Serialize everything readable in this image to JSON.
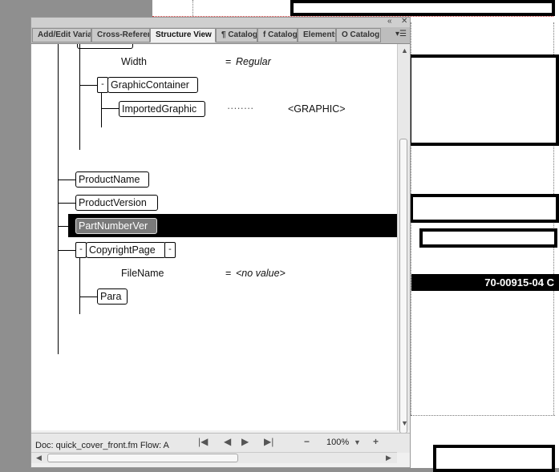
{
  "window_controls": {
    "collapse": "«",
    "close": "✕"
  },
  "tabs": [
    {
      "label": "Add/Edit Variable"
    },
    {
      "label": "Cross-Reference"
    },
    {
      "label": "Structure View"
    },
    {
      "label": "¶ Catalog"
    },
    {
      "label": "f Catalog"
    },
    {
      "label": "Elements"
    },
    {
      "label": "O Catalog"
    }
  ],
  "tab_menu": "▾☰",
  "tree": {
    "width_attr": {
      "name": "Width",
      "eq": "=",
      "value": "Regular"
    },
    "graphic_container": {
      "toggle": "-",
      "label": "GraphicContainer"
    },
    "imported_graphic": {
      "label": "ImportedGraphic",
      "dots": "········",
      "value": "<GRAPHIC>"
    },
    "product_name": {
      "label": "ProductName"
    },
    "product_version": {
      "label": "ProductVersion"
    },
    "part_number": {
      "label": "PartNumberVer"
    },
    "copyright_page": {
      "toggle_left": "-",
      "label": "CopyrightPage",
      "toggle_right": "-"
    },
    "filename_attr": {
      "name": "FileName",
      "eq": "=",
      "value": "<no value>"
    },
    "para": {
      "label": "Para"
    }
  },
  "statusbar": {
    "doc_info": "Doc: quick_cover_front.fm Flow: A",
    "nav_first": "|◀",
    "nav_prev": "◀",
    "nav_next": "▶",
    "nav_last": "▶|",
    "zoom_out": "−",
    "zoom": "100%",
    "zoom_dropdown": "▼",
    "zoom_in": "+"
  },
  "document": {
    "part_number_text": "70-00915-04 C"
  },
  "colors": {
    "selection": "#000000",
    "panel_bg": "#f0f0f0",
    "tab_bg": "#bdbdbd"
  }
}
